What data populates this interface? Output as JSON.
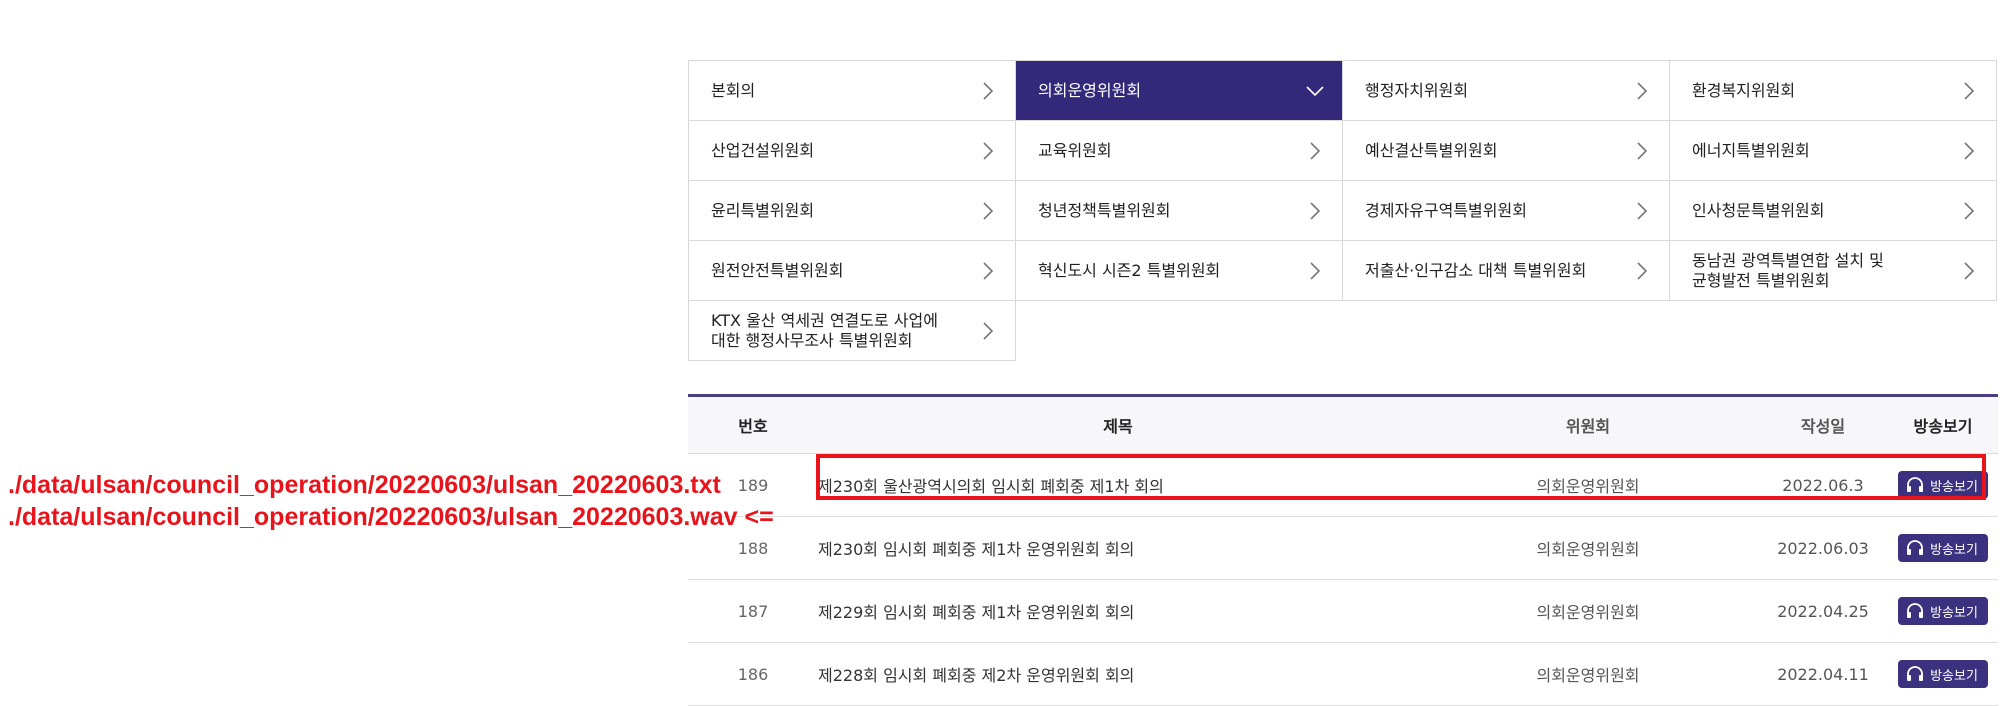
{
  "committees": [
    {
      "label": "본회의",
      "active": false
    },
    {
      "label": "의회운영위원회",
      "active": true
    },
    {
      "label": "행정자치위원회",
      "active": false
    },
    {
      "label": "환경복지위원회",
      "active": false
    },
    {
      "label": "산업건설위원회",
      "active": false
    },
    {
      "label": "교육위원회",
      "active": false
    },
    {
      "label": "예산결산특별위원회",
      "active": false
    },
    {
      "label": "에너지특별위원회",
      "active": false
    },
    {
      "label": "윤리특별위원회",
      "active": false
    },
    {
      "label": "청년정책특별위원회",
      "active": false
    },
    {
      "label": "경제자유구역특별위원회",
      "active": false
    },
    {
      "label": "인사청문특별위원회",
      "active": false
    },
    {
      "label": "원전안전특별위원회",
      "active": false
    },
    {
      "label": "혁신도시 시즌2 특별위원회",
      "active": false
    },
    {
      "label": "저출산·인구감소 대책 특별위원회",
      "active": false
    },
    {
      "label": "동남권 광역특별연합 설치 및\n균형발전 특별위원회",
      "active": false
    },
    {
      "label": "KTX 울산 역세권 연결도로 사업에\n대한 행정사무조사 특별위원회",
      "active": false
    }
  ],
  "table": {
    "headers": {
      "num": "번호",
      "title": "제목",
      "committee": "위원회",
      "date": "작성일",
      "broadcast": "방송보기"
    },
    "rows": [
      {
        "num": "189",
        "title": "제230회 울산광역시의회 임시회 폐회중 제1차 회의",
        "committee": "의회운영위원회",
        "date": "2022.06.3",
        "button": "방송보기"
      },
      {
        "num": "188",
        "title": "제230회 임시회 폐회중 제1차 운영위원회 회의",
        "committee": "의회운영위원회",
        "date": "2022.06.03",
        "button": "방송보기"
      },
      {
        "num": "187",
        "title": "제229회 임시회 폐회중 제1차 운영위원회 회의",
        "committee": "의회운영위원회",
        "date": "2022.04.25",
        "button": "방송보기"
      },
      {
        "num": "186",
        "title": "제228회 임시회 폐회중 제2차 운영위원회 회의",
        "committee": "의회운영위원회",
        "date": "2022.04.11",
        "button": "방송보기"
      }
    ]
  },
  "annotation": {
    "line1": "./data/ulsan/council_operation/20220603/ulsan_20220603.txt",
    "line2": "./data/ulsan/council_operation/20220603/ulsan_20220603.wav <="
  },
  "colors": {
    "accent": "#33287a",
    "highlight": "#e8141c"
  },
  "icons": {
    "chevron_right": "chevron-right-icon",
    "chevron_down": "chevron-down-icon",
    "headphones": "headphones-icon"
  }
}
